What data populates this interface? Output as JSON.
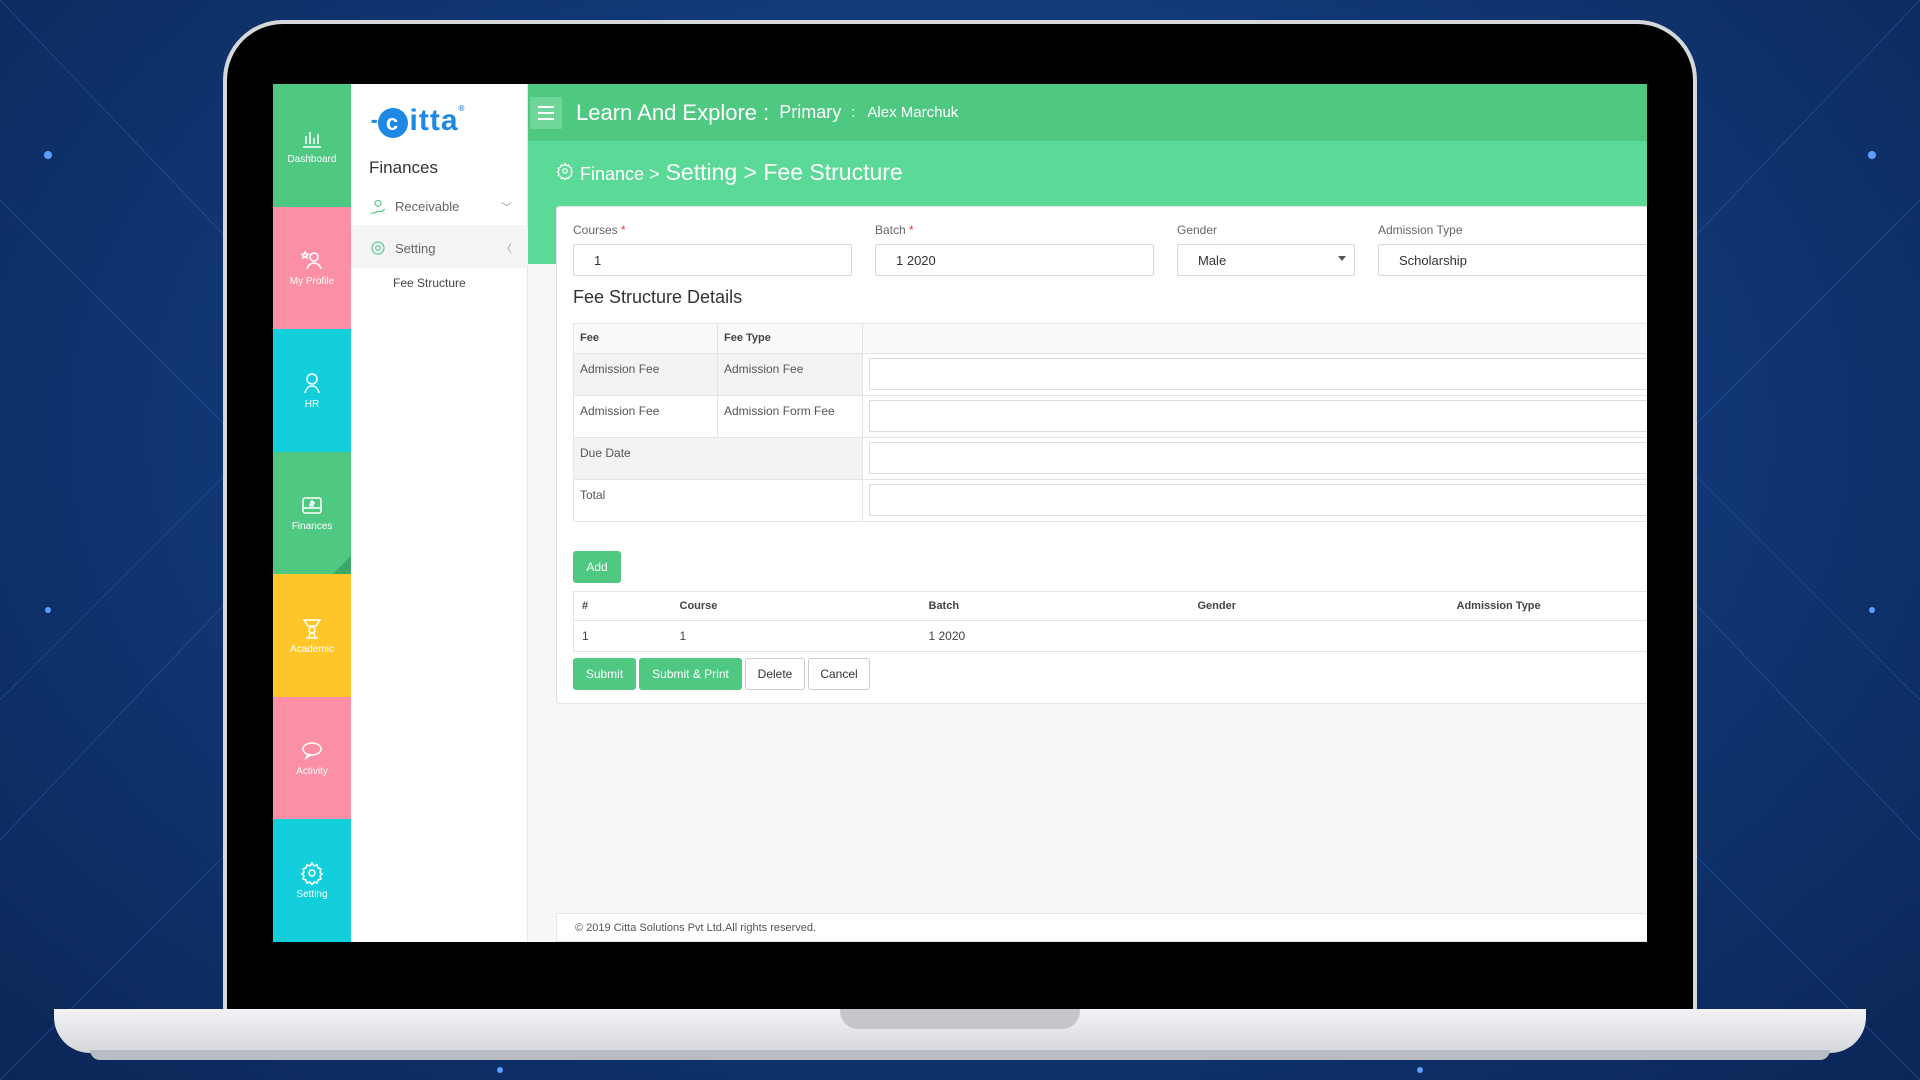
{
  "sidebar_rail": [
    {
      "label": "Dashboard",
      "icon": "dashboard-chart-icon",
      "color": "#4fc882"
    },
    {
      "label": "My Profile",
      "icon": "profile-star-icon",
      "color": "#fb8fa6"
    },
    {
      "label": "HR",
      "icon": "hr-person-icon",
      "color": "#13cfdb"
    },
    {
      "label": "Finances",
      "icon": "wallet-dollar-icon",
      "color": "#4fc882"
    },
    {
      "label": "Academic",
      "icon": "academic-award-icon",
      "color": "#ffc629"
    },
    {
      "label": "Activity",
      "icon": "chat-bubble-icon",
      "color": "#fb8fa6"
    },
    {
      "label": "Setting",
      "icon": "gear-icon",
      "color": "#13cfdb"
    }
  ],
  "submenu": {
    "logo": "itta",
    "logo_c": "c",
    "logo_reg": "®",
    "title": "Finances",
    "items": [
      {
        "label": "Receivable",
        "icon": "money-hand-icon",
        "chevron": "﹀"
      },
      {
        "label": "Setting",
        "icon": "gear-icon",
        "chevron": "〈"
      }
    ],
    "child": "Fee Structure"
  },
  "topbar": {
    "title": "Learn And Explore :",
    "level": "Primary",
    "separator": ":",
    "user": "Alex Marchuk"
  },
  "breadcrumb": {
    "part1": "Finance >",
    "part2": "Setting > Fee Structure"
  },
  "form": {
    "courses_label": "Courses",
    "courses_value": "1",
    "batch_label": "Batch",
    "batch_value": "1 2020",
    "gender_label": "Gender",
    "gender_value": "Male",
    "admission_label": "Admission Type",
    "admission_value": "Scholarship",
    "required_mark": "*"
  },
  "fee_details": {
    "title": "Fee Structure Details",
    "headers": [
      "Fee",
      "Fee Type"
    ],
    "rows": [
      {
        "fee": "Admission Fee",
        "type": "Admission Fee"
      },
      {
        "fee": "Admission Fee",
        "type": "Admission Form Fee"
      }
    ],
    "due_date": "Due Date",
    "total": "Total"
  },
  "buttons": {
    "add": "Add",
    "submit": "Submit",
    "submit_print": "Submit & Print",
    "delete": "Delete",
    "cancel": "Cancel"
  },
  "list": {
    "headers": [
      "#",
      "Course",
      "Batch",
      "Gender",
      "Admission Type"
    ],
    "rows": [
      [
        "1",
        "1",
        "1 2020",
        "",
        ""
      ]
    ]
  },
  "footer": "© 2019 Citta Solutions Pvt Ltd.All rights reserved."
}
